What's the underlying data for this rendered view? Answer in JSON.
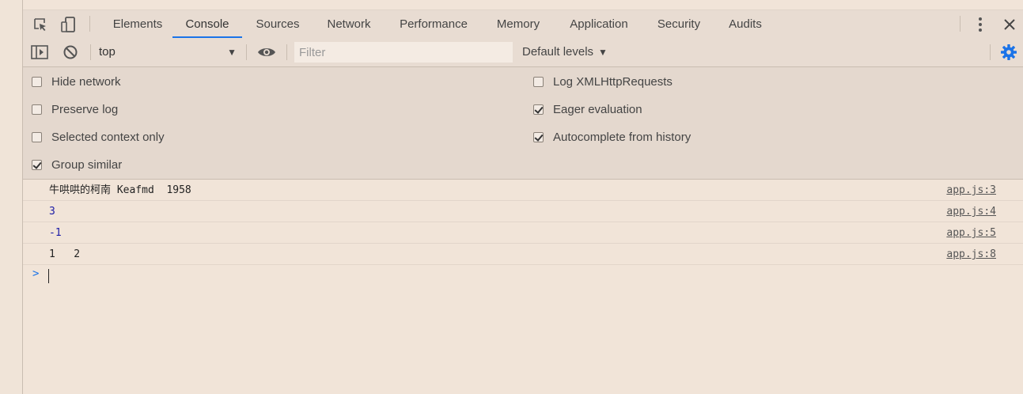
{
  "tabs": [
    {
      "label": "Elements"
    },
    {
      "label": "Console"
    },
    {
      "label": "Sources"
    },
    {
      "label": "Network"
    },
    {
      "label": "Performance"
    },
    {
      "label": "Memory"
    },
    {
      "label": "Application"
    },
    {
      "label": "Security"
    },
    {
      "label": "Audits"
    }
  ],
  "active_tab": "Console",
  "toolbar": {
    "context": "top",
    "filter_placeholder": "Filter",
    "filter_value": "",
    "levels_label": "Default levels"
  },
  "settings": {
    "left": [
      {
        "label": "Hide network",
        "checked": false
      },
      {
        "label": "Preserve log",
        "checked": false
      },
      {
        "label": "Selected context only",
        "checked": false
      },
      {
        "label": "Group similar",
        "checked": true
      }
    ],
    "right": [
      {
        "label": "Log XMLHttpRequests",
        "checked": false
      },
      {
        "label": "Eager evaluation",
        "checked": true
      },
      {
        "label": "Autocomplete from history",
        "checked": true
      }
    ]
  },
  "messages": [
    {
      "text": "牛哄哄的柯南 Keafmd  1958",
      "source": "app.js:3",
      "kind": "string"
    },
    {
      "text": "3",
      "source": "app.js:4",
      "kind": "number"
    },
    {
      "text": "-1",
      "source": "app.js:5",
      "kind": "number"
    },
    {
      "text": "1   2",
      "source": "app.js:8",
      "kind": "string"
    }
  ],
  "colors": {
    "accent": "#1a73e8",
    "background": "#f1e4d8",
    "number": "#1a1aa6"
  }
}
